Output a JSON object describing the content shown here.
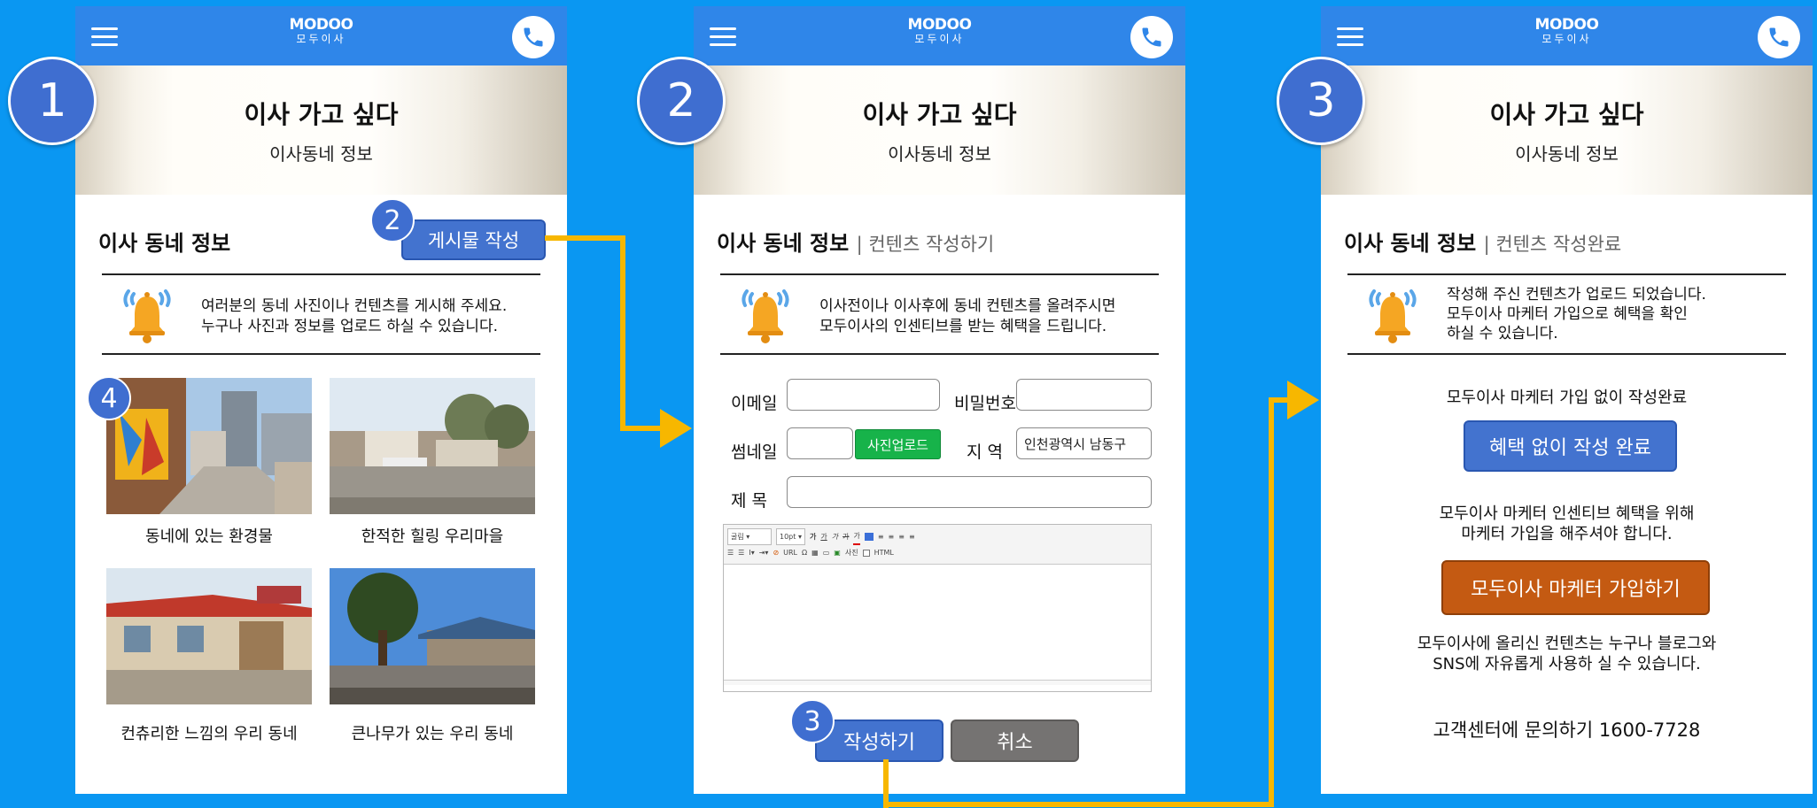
{
  "app": {
    "logo_en": "MODOO",
    "logo_ko": "모두이사"
  },
  "hero": {
    "title": "이사 가고 싶다",
    "subtitle": "이사동네 정보"
  },
  "steps": [
    "1",
    "2",
    "3",
    "4"
  ],
  "screen1": {
    "section_title": "이사 동네 정보",
    "write_button": "게시물 작성",
    "notice_line1": "여러분의 동네 사진이나 컨텐츠를 게시해 주세요.",
    "notice_line2": "누구나 사진과 정보를 업로드 하실 수 있습니다.",
    "posts": [
      {
        "caption": "동네에 있는 환경물"
      },
      {
        "caption": "한적한 힐링 우리마을"
      },
      {
        "caption": "컨츄리한 느낌의 우리 동네"
      },
      {
        "caption": "큰나무가 있는 우리 동네"
      }
    ]
  },
  "screen2": {
    "section_title": "이사 동네 정보",
    "section_sub": "| 컨텐츠 작성하기",
    "notice_line1": "이사전이나 이사후에 동네 컨텐츠를 올려주시면",
    "notice_line2": "모두이사의 인센티브를 받는 혜택을 드립니다.",
    "email_label": "이메일",
    "password_label": "비밀번호",
    "thumbnail_label": "썸네일",
    "upload_button": "사진업로드",
    "region_label": "지 역",
    "region_value": "인천광역시 남동구",
    "title_label": "제 목",
    "editor": {
      "font": "굴림",
      "size": "10pt",
      "bold": "가",
      "underline": "가",
      "italic": "가",
      "strike": "가",
      "color": "가",
      "url": "URL",
      "photo": "사진",
      "html": "HTML"
    },
    "submit_button": "작성하기",
    "cancel_button": "취소"
  },
  "screen3": {
    "section_title": "이사 동네 정보",
    "section_sub": "| 컨텐츠 작성완료",
    "notice_line1": "작성해 주신 컨텐츠가 업로드 되었습니다.",
    "notice_line2": "모두이사 마케터 가입으로 혜택을 확인",
    "notice_line3": "하실 수 있습니다.",
    "no_marketer_text": "모두이사 마케터 가입 없이 작성완료",
    "complete_button": "혜택 없이 작성 완료",
    "incentive_line1": "모두이사 마케터 인센티브 혜택을 위해",
    "incentive_line2": "마케터 가입을 해주셔야 합니다.",
    "marketer_button": "모두이사 마케터 가입하기",
    "usage_line1": "모두이사에 올리신 컨텐츠는 누구나 블로그와",
    "usage_line2": "SNS에 자유롭게 사용하 실 수 있습니다.",
    "support_text": "고객센터에 문의하기 1600-7728"
  },
  "colors": {
    "background": "#0a97f2",
    "topbar": "#2f86e9",
    "badge": "#3f6ed0",
    "connector": "#f7b700",
    "upload_green": "#17b34a",
    "marketer_orange": "#c45a12",
    "cancel_gray": "#757372"
  }
}
